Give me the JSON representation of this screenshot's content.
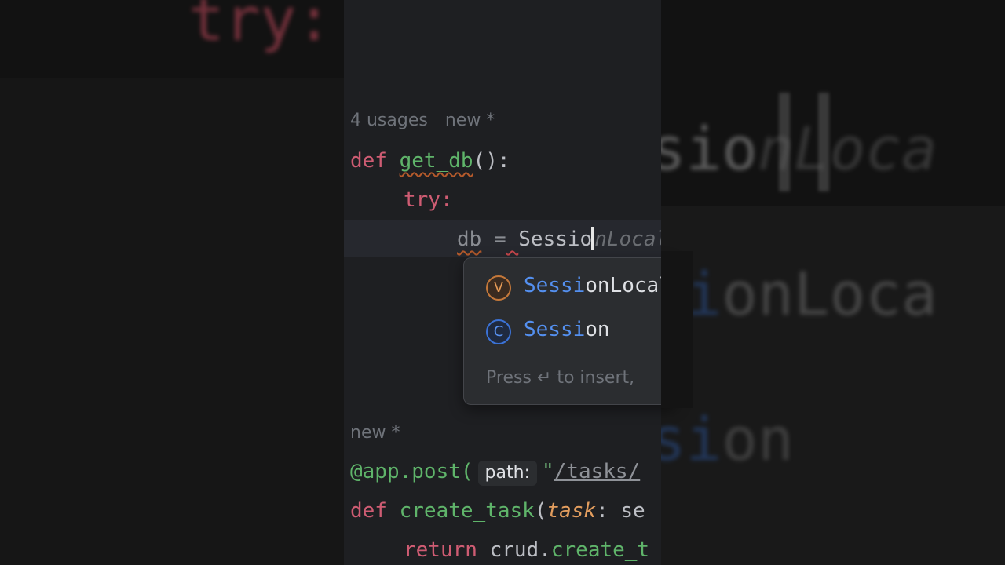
{
  "background": {
    "left_try": "try:",
    "right_session_typed": "ssio",
    "right_session_ghost": "nLoca",
    "right_item1_match": "ssi",
    "right_item1_rest": "onLoca",
    "right_item2_match": "ssi",
    "right_item2_rest": "on"
  },
  "editor": {
    "hint1_usages": "4 usages",
    "hint1_new": "new *",
    "line_def": "def",
    "line_func": "get_db",
    "line_parens": "():",
    "line_try": "try:",
    "line_var": "db",
    "line_eq": "=",
    "line_typed": "Sessio",
    "line_ghost": "nLocal",
    "hint2_new": "new *",
    "decorator": "@app.post(",
    "inlay_path": "path:",
    "path_quote": "\"",
    "path_value": "/tasks/",
    "def2": "def",
    "func2": "create_task",
    "paren_open": "(",
    "param_task": "task",
    "colon": ":",
    "type_start": "se",
    "return_kw": "return",
    "return_obj": "crud",
    "return_dot": ".",
    "return_fn": "create_t"
  },
  "completion": {
    "items": [
      {
        "icon": "V",
        "icon_name": "variable-icon",
        "match": "Sessi",
        "rest": "onLocal"
      },
      {
        "icon": "C",
        "icon_name": "class-icon",
        "match": "Sessi",
        "rest": "on"
      }
    ],
    "footer": "Press ↵ to insert,"
  },
  "colors": {
    "keyword": "#cf5c73",
    "function": "#5fb46a",
    "match": "#5490f0",
    "param": "#e39d5e"
  }
}
